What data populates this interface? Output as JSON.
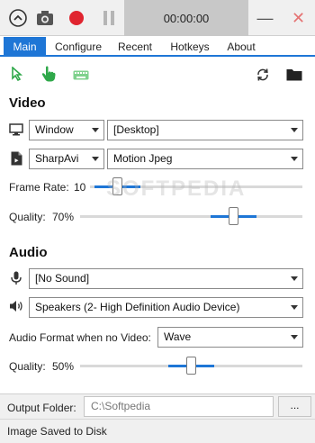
{
  "titlebar": {
    "timer": "00:00:00",
    "minimize_glyph": "—",
    "close_glyph": "✕",
    "icons": [
      "collapse-icon",
      "screenshot-camera-icon",
      "record-icon",
      "pause-icon"
    ]
  },
  "tabs": [
    {
      "label": "Main",
      "active": true
    },
    {
      "label": "Configure",
      "active": false
    },
    {
      "label": "Recent",
      "active": false
    },
    {
      "label": "Hotkeys",
      "active": false
    },
    {
      "label": "About",
      "active": false
    }
  ],
  "toolbar": {
    "left_icons": [
      "cursor-icon",
      "click-hand-icon",
      "keyboard-icon"
    ],
    "right_icons": [
      "refresh-icon",
      "folder-icon"
    ]
  },
  "video": {
    "title": "Video",
    "source_type": "Window",
    "source": "[Desktop]",
    "encoder": "SharpAvi",
    "codec": "Motion Jpeg",
    "frame_rate_label": "Frame Rate:",
    "frame_rate_value": "10",
    "frame_rate_fraction": 0.11,
    "quality_label": "Quality:",
    "quality_value": "70%",
    "quality_fraction": 0.7
  },
  "audio": {
    "title": "Audio",
    "microphone": "[No Sound]",
    "speakers": "Speakers (2- High Definition Audio Device)",
    "format_label": "Audio Format when no Video:",
    "format_value": "Wave",
    "quality_label": "Quality:",
    "quality_value": "50%",
    "quality_fraction": 0.5
  },
  "output": {
    "label": "Output Folder:",
    "path": "C:\\Softpedia",
    "browse_label": "..."
  },
  "status": {
    "text": "Image Saved to Disk"
  },
  "watermark": "SOFTPEDIA",
  "colors": {
    "accent": "#1e76d6",
    "record": "#e0242f",
    "cursor_icon": "#2fa84a",
    "timer_bg": "#c8c8c8"
  }
}
